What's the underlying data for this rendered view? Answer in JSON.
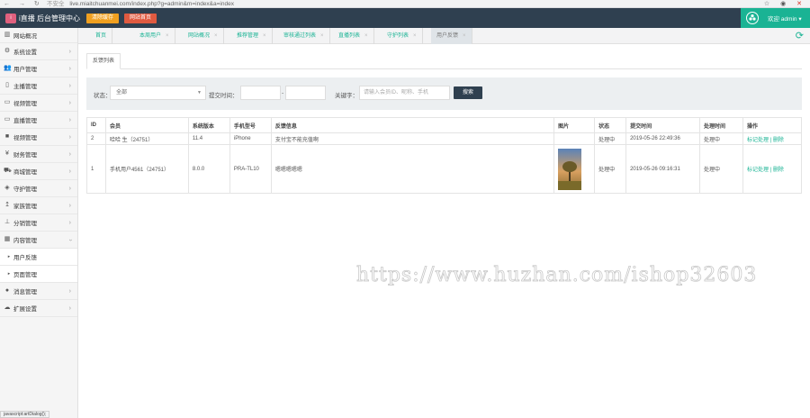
{
  "browser": {
    "security": "不安全",
    "url": "live.miaitchuanmei.com/index.php?g=admin&m=index&a=index"
  },
  "header": {
    "logo_text": "i",
    "title": "i直播 后台管理中心",
    "clear_cache": "清除缓存",
    "site_home": "网站首页",
    "user_label": "欢迎 admin"
  },
  "sidebar": {
    "home": "网站概况",
    "items": [
      {
        "label": "系统设置",
        "icon": "gear-icon",
        "glyph": "⚙"
      },
      {
        "label": "用户管理",
        "icon": "users-icon",
        "glyph": "👥"
      },
      {
        "label": "主播管理",
        "icon": "mobile-icon",
        "glyph": "▯"
      },
      {
        "label": "视频管理",
        "icon": "monitor-icon",
        "glyph": "▭"
      },
      {
        "label": "直播管理",
        "icon": "desktop-icon",
        "glyph": "▭"
      },
      {
        "label": "视频管理",
        "icon": "video-camera-icon",
        "glyph": "■"
      },
      {
        "label": "财务管理",
        "icon": "yen-icon",
        "glyph": "¥"
      },
      {
        "label": "商城管理",
        "icon": "cart-icon",
        "glyph": "⛟"
      },
      {
        "label": "守护管理",
        "icon": "shield-icon",
        "glyph": "◈"
      },
      {
        "label": "家族管理",
        "icon": "arrow-up-icon",
        "glyph": "↥"
      },
      {
        "label": "分销管理",
        "icon": "sitemap-icon",
        "glyph": "⊥"
      },
      {
        "label": "内容管理",
        "icon": "grid-icon",
        "glyph": "▦"
      }
    ],
    "subitems": [
      "用户反馈",
      "页面管理"
    ],
    "after": [
      {
        "label": "消息管理",
        "icon": "bell-icon",
        "glyph": "●"
      },
      {
        "label": "扩展设置",
        "icon": "cloud-icon",
        "glyph": "☁"
      }
    ]
  },
  "tabs": [
    {
      "label": "首页"
    },
    {
      "label": "本周用户"
    },
    {
      "label": "网站概况"
    },
    {
      "label": "推荐管理"
    },
    {
      "label": "审核通过列表"
    },
    {
      "label": "直播列表"
    },
    {
      "label": "守护列表"
    },
    {
      "label": "用户反馈"
    }
  ],
  "page": {
    "subtab": "反馈列表",
    "filter": {
      "status_label": "状态：",
      "status_value": "全部",
      "time_label": "提交时间：",
      "keyword_label": "关键字：",
      "keyword_placeholder": "请输入会员ID、昵称、手机",
      "search_button": "搜索",
      "dash": "-"
    },
    "columns": [
      "ID",
      "会员",
      "系统版本",
      "手机型号",
      "反馈信息",
      "图片",
      "状态",
      "提交时间",
      "处理时间",
      "操作"
    ],
    "rows": [
      {
        "id": "2",
        "member": "哈哈 生（24751）",
        "version": "11.4",
        "model": "iPhone",
        "info": "支付宝不能充值啊",
        "status": "处理中",
        "submit_time": "2019-05-26 22:49:36",
        "handle_time": "处理中",
        "action_handle": "标记处理",
        "action_delete": "删除"
      },
      {
        "id": "1",
        "member": "手机用户4561（24751）",
        "version": "8.0.0",
        "model": "PRA-TL10",
        "info": "嗯嗯嗯嗯嗯",
        "status": "处理中",
        "submit_time": "2019-05-26 09:16:31",
        "handle_time": "处理中",
        "action_handle": "标记处理",
        "action_delete": "删除"
      }
    ]
  },
  "watermark": "https://www.huzhan.com/ishop32603",
  "statusbar": "javascript:artDialog();",
  "colors": {
    "primary": "#1ab394",
    "dark": "#2f4050",
    "orange": "#f0a020",
    "red": "#e05a40"
  }
}
